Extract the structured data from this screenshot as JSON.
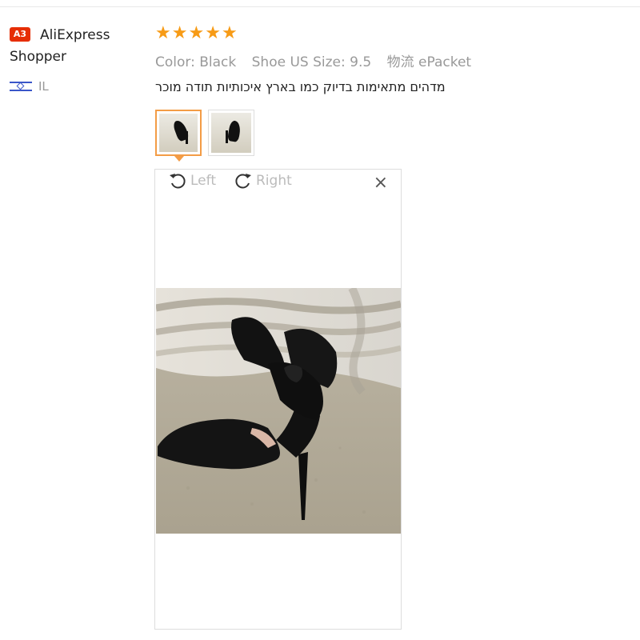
{
  "reviewer": {
    "level_badge": "A3",
    "name": "AliExpress Shopper",
    "country": "IL"
  },
  "review": {
    "rating": 5,
    "stars": [
      "★",
      "★",
      "★",
      "★",
      "★"
    ],
    "attributes": [
      {
        "label": "Color:",
        "value": "Black"
      },
      {
        "label": "Shoe US Size:",
        "value": "9.5"
      },
      {
        "label": "物流",
        "value": "ePacket"
      }
    ],
    "text": "מדהים מתאימות בדיוק כמו בארץ איכותיות תודה מוכר"
  },
  "thumbnails": [
    {
      "icon": "shoe-photo-thumbnail",
      "selected": true
    },
    {
      "icon": "shoe-photo-thumbnail",
      "selected": false
    }
  ],
  "viewer": {
    "rotate_left_label": "Left",
    "rotate_right_label": "Right",
    "close_icon": "×"
  },
  "colors": {
    "star": "#f79b16",
    "badge": "#e62e04",
    "thumb_selected_border": "#f39c46",
    "muted_text": "#999999"
  }
}
